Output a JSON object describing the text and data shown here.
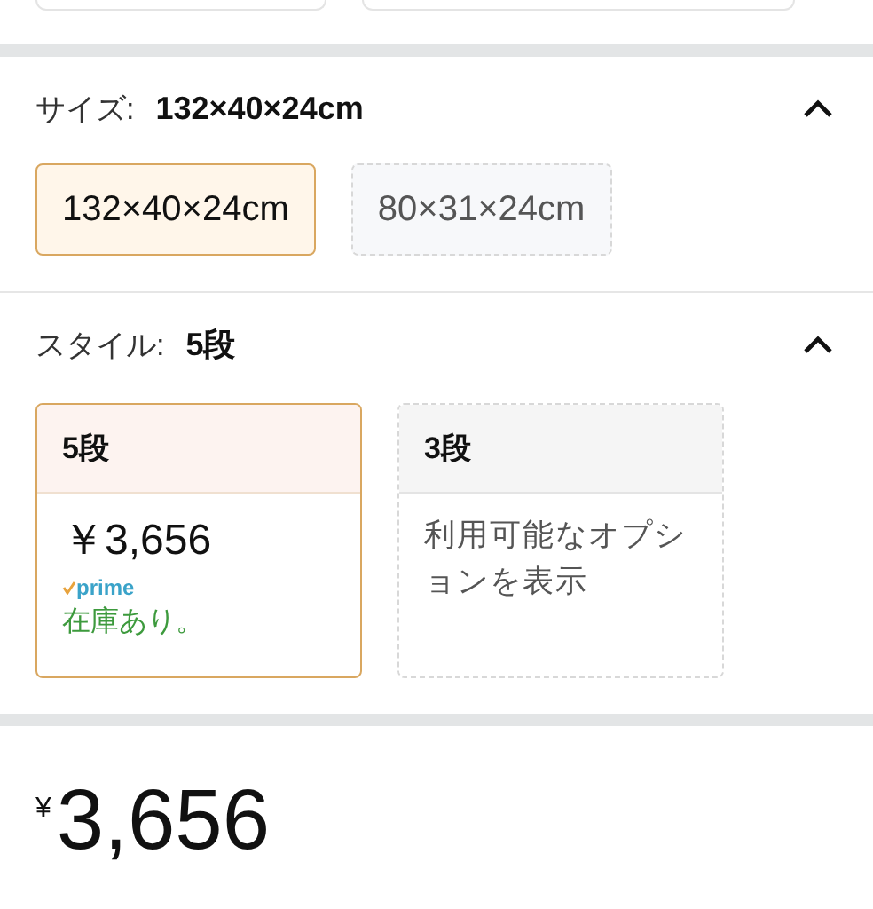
{
  "size_section": {
    "label": "サイズ:",
    "value": "132×40×24cm",
    "expanded": true,
    "options": [
      {
        "label": "132×40×24cm",
        "selected": true
      },
      {
        "label": "80×31×24cm",
        "selected": false
      }
    ]
  },
  "style_section": {
    "label": "スタイル:",
    "value": "5段",
    "expanded": true,
    "options": [
      {
        "title": "5段",
        "selected": true,
        "price": "￥3,656",
        "prime": "prime",
        "stock": "在庫あり。"
      },
      {
        "title": "3段",
        "selected": false,
        "note": "利用可能なオプションを表示"
      }
    ]
  },
  "price": {
    "currency": "¥",
    "amount": "3,656"
  }
}
